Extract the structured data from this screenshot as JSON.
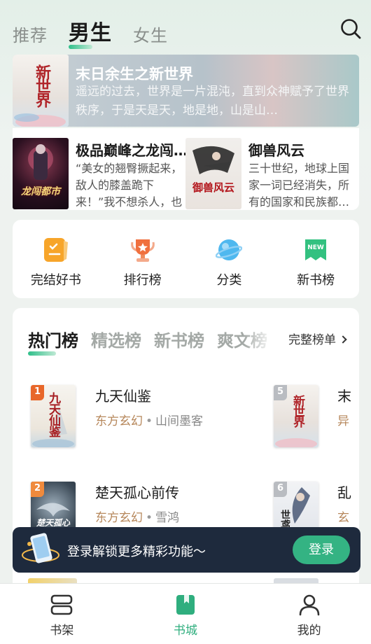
{
  "top_tabs": [
    {
      "label": "推荐",
      "active": false
    },
    {
      "label": "男生",
      "active": true
    },
    {
      "label": "女生",
      "active": false
    }
  ],
  "search_icon": "search-icon",
  "banner": {
    "title": "末日余生之新世界",
    "description": "遥远的过去，世界是一片混沌，直到众神赋予了世界秩序，于是天是天，地是地，山是山…",
    "cover_text": "新世界"
  },
  "featured": [
    {
      "title": "极品巅峰之龙闯…",
      "description": "“美女的翘臀撅起来，敌人的膝盖跪下来！”我不想杀人，也不…",
      "cover_text": "龙闯都市"
    },
    {
      "title": "御兽风云",
      "description": "三十世纪，地球上国家一词已经消失，所有的国家和民族都…",
      "cover_text": "御兽风云"
    }
  ],
  "shortcuts": [
    {
      "label": "完结好书",
      "icon": "completed-books-icon"
    },
    {
      "label": "排行榜",
      "icon": "trophy-icon"
    },
    {
      "label": "分类",
      "icon": "category-planet-icon"
    },
    {
      "label": "新书榜",
      "icon": "new-badge-icon"
    }
  ],
  "ranking": {
    "tabs": [
      {
        "label": "热门榜",
        "active": true
      },
      {
        "label": "精选榜",
        "active": false
      },
      {
        "label": "新书榜",
        "active": false
      },
      {
        "label": "爽文榜",
        "active": false
      }
    ],
    "full_list_label": "完整榜单",
    "left_column": [
      {
        "rank": "1",
        "title": "九天仙鉴",
        "category": "东方玄幻",
        "author": "山间墨客",
        "cover_text": "九天仙鉴"
      },
      {
        "rank": "2",
        "title": "楚天孤心前传",
        "category": "东方玄幻",
        "author": "雪鸿",
        "cover_text": "楚天孤心"
      }
    ],
    "right_column": [
      {
        "rank": "5",
        "title": "末",
        "category": "异",
        "cover_text": "新世界"
      },
      {
        "rank": "6",
        "title": "乱",
        "category": "玄",
        "cover_text": "世鸢"
      }
    ]
  },
  "login_prompt": {
    "text": "登录解锁更多精彩功能～",
    "button": "登录"
  },
  "bottom_nav": [
    {
      "label": "书架",
      "icon": "bookshelf-icon",
      "active": false
    },
    {
      "label": "书城",
      "icon": "bookstore-icon",
      "active": true
    },
    {
      "label": "我的",
      "icon": "profile-icon",
      "active": false
    }
  ],
  "colors": {
    "accent": "#2fae7e",
    "rank_1": "#e8672a",
    "rank_2": "#f08a3c",
    "rank_other": "#b9bcc1",
    "category": "#b6875b",
    "login_bar": "#1e2a3d"
  }
}
